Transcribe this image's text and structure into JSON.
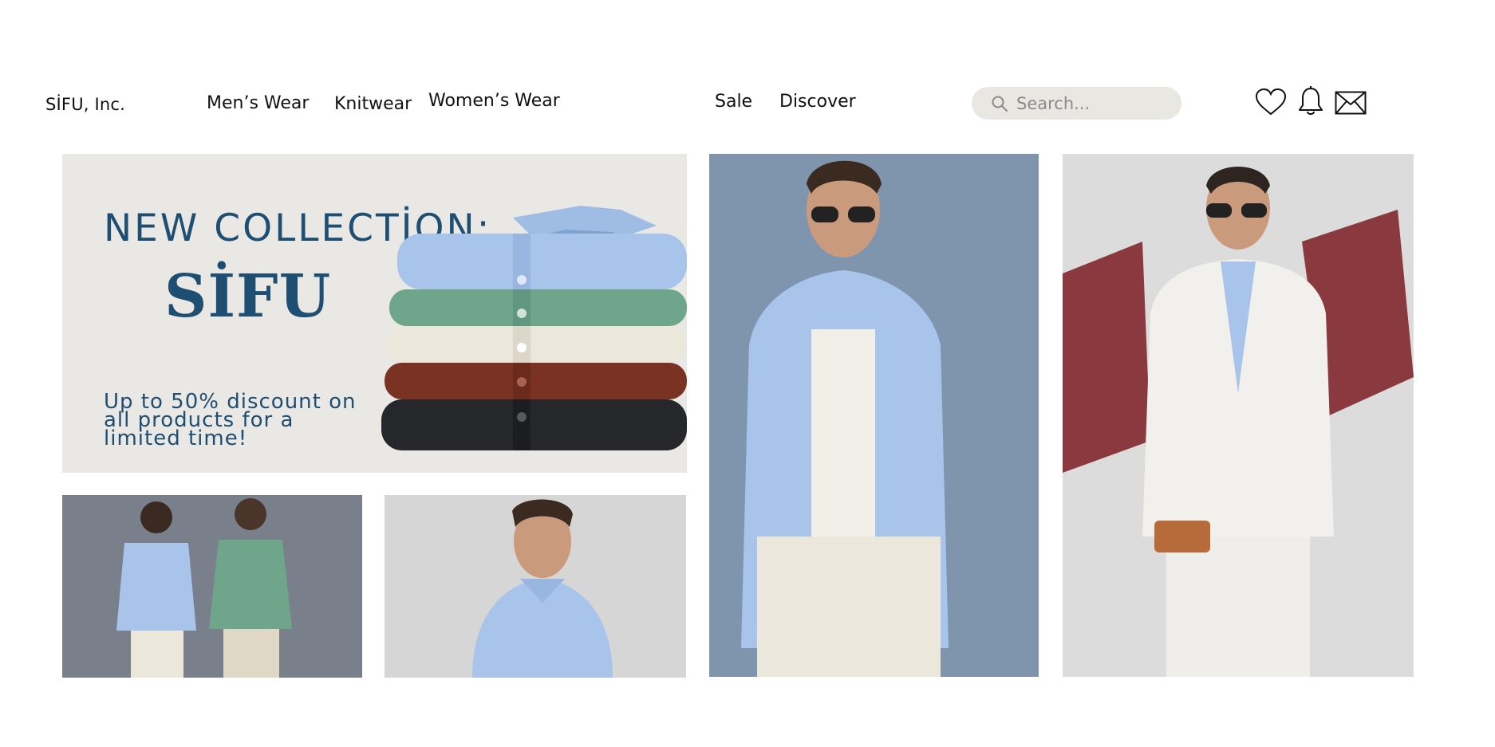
{
  "header": {
    "brand": "SİFU, Inc.",
    "nav": [
      "Men’s Wear",
      "Knitwear",
      "Women’s Wear",
      "Sale",
      "Discover"
    ],
    "search": {
      "placeholder": "Search..."
    },
    "icons": [
      "heart-icon",
      "bell-icon",
      "mail-icon"
    ]
  },
  "banner": {
    "title": "NEW COLLECTİON:",
    "logo": "SİFU",
    "subtitle": "Up to 50% discount on all products for a limited time!"
  },
  "tiles": [
    "two-men-knit-shirts-photo",
    "man-blue-knit-polo-photo",
    "man-sunglasses-blue-knit-shirt-photo",
    "man-white-suit-carpet-photo"
  ],
  "colors": {
    "accent_navy": "#1f4e73",
    "banner_bg": "#e9e8e4",
    "search_bg": "#e9e7e1",
    "slate_blue": "#7f95ae",
    "grey_blue": "#7a7f8c",
    "light_grey": "#d9d9d9"
  }
}
